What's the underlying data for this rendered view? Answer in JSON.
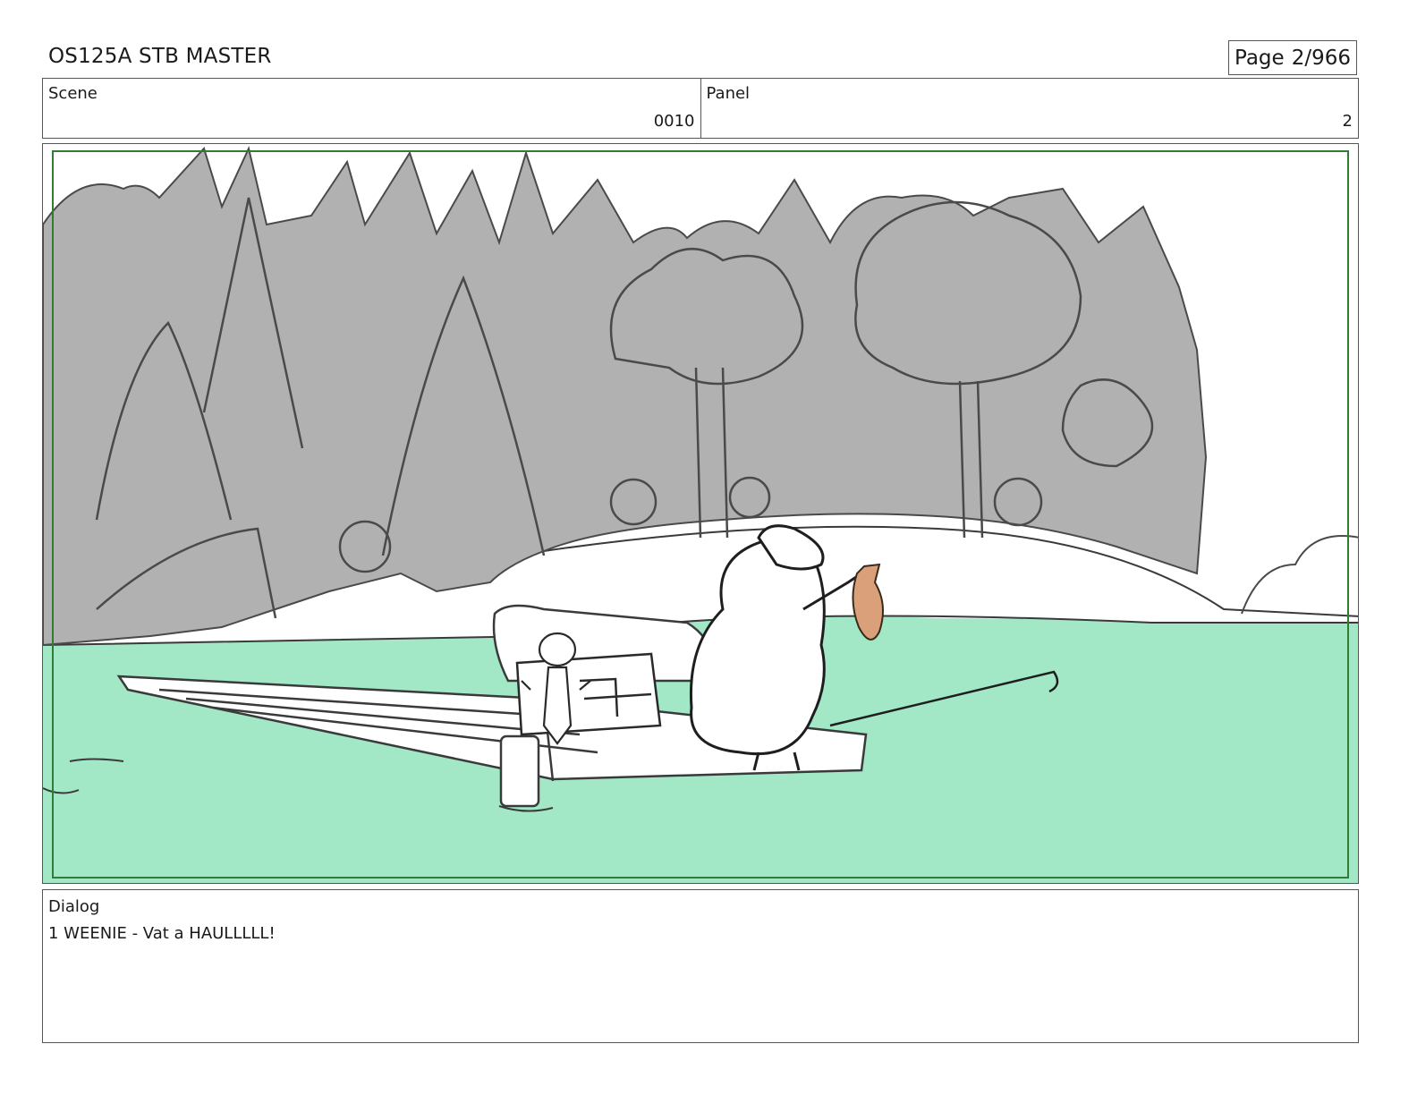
{
  "header": {
    "title": "OS125A STB MASTER",
    "page_label": "Page",
    "page_value": "2/966"
  },
  "scene": {
    "label": "Scene",
    "value": "0010"
  },
  "panel": {
    "label": "Panel",
    "value": "2"
  },
  "dialog": {
    "label": "Dialog",
    "lines": [
      "1 WEENIE - Vat a HAULLLLL!"
    ]
  },
  "colors": {
    "water": "#a2e8c6",
    "foliage": "#b1b1b1",
    "safe_frame": "#2e7d32",
    "fish": "#d9a07a",
    "line": "#3a3a3a"
  }
}
